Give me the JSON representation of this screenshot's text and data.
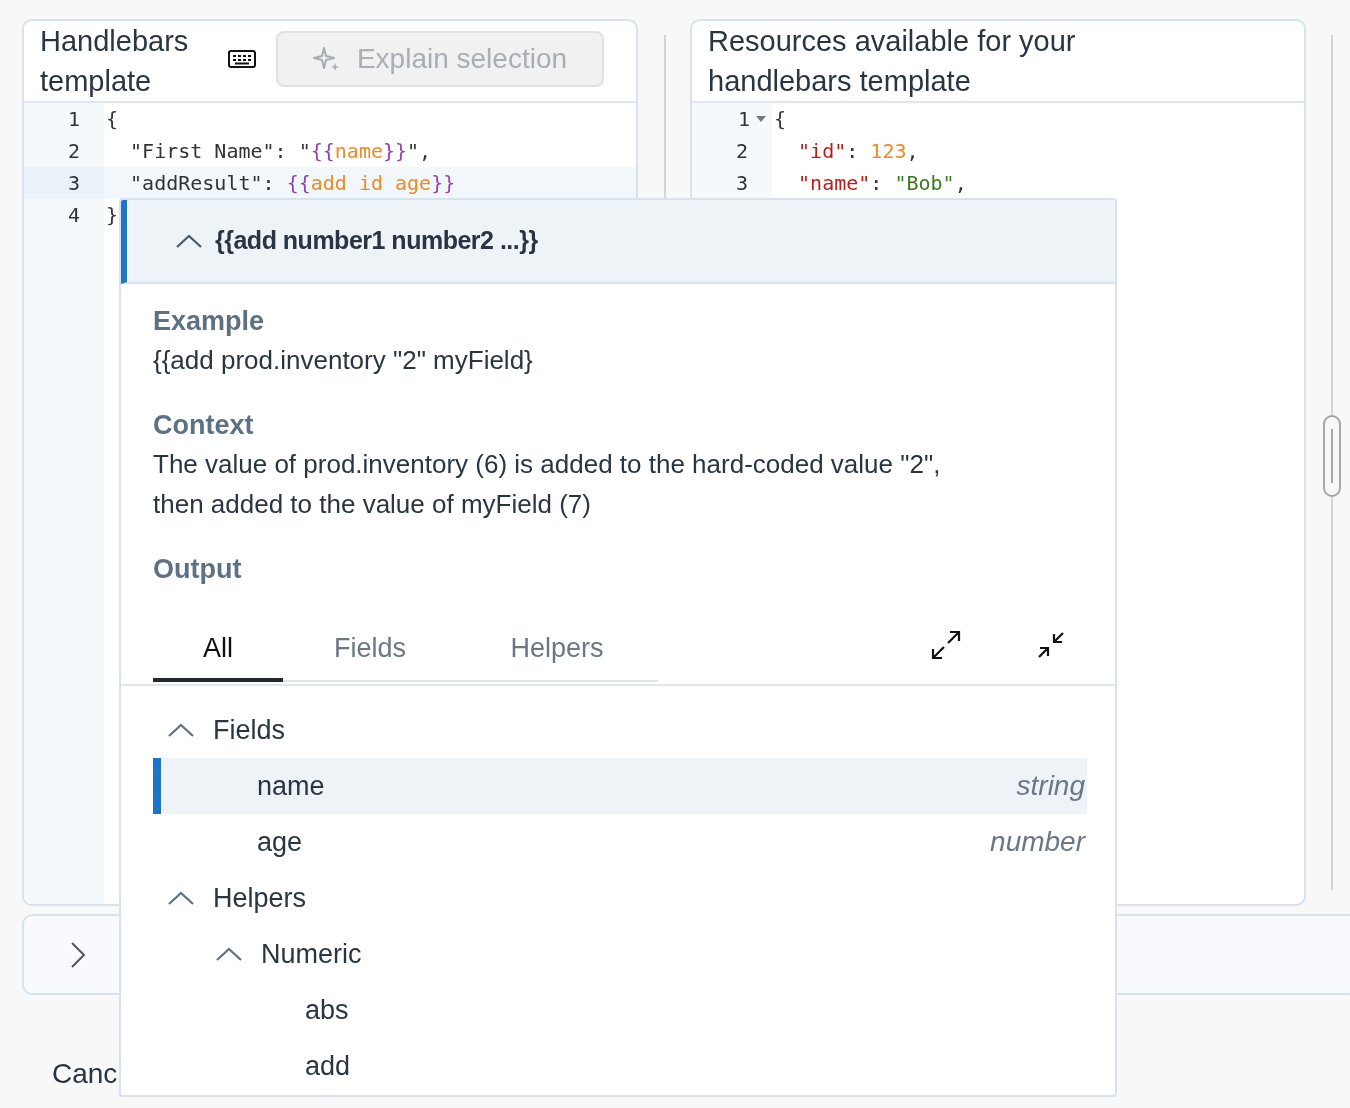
{
  "template_panel": {
    "title": "Handlebars template",
    "explain_button": {
      "label": "Explain selection",
      "disabled": true
    },
    "lines": [
      {
        "number": "1",
        "active": false,
        "tokens": [
          {
            "text": "{",
            "kind": "plain"
          }
        ]
      },
      {
        "number": "2",
        "active": false,
        "tokens": [
          {
            "text": "  \"First Name\": \"",
            "kind": "plain"
          },
          {
            "text": "{{",
            "kind": "brace"
          },
          {
            "text": "name",
            "kind": "helper"
          },
          {
            "text": "}}",
            "kind": "brace"
          },
          {
            "text": "\",",
            "kind": "plain"
          }
        ]
      },
      {
        "number": "3",
        "active": true,
        "tokens": [
          {
            "text": "  \"addResult\": ",
            "kind": "plain"
          },
          {
            "text": "{{",
            "kind": "brace"
          },
          {
            "text": "add id age",
            "kind": "helper"
          },
          {
            "text": "}}",
            "kind": "brace"
          }
        ]
      },
      {
        "number": "4",
        "active": false,
        "tokens": [
          {
            "text": "}",
            "kind": "plain"
          }
        ]
      }
    ]
  },
  "resources_panel": {
    "title": "Resources available for your handlebars template",
    "lines": [
      {
        "number": "1",
        "foldable": true,
        "tokens": [
          {
            "text": "{",
            "kind": "plain"
          }
        ]
      },
      {
        "number": "2",
        "foldable": false,
        "tokens": [
          {
            "text": "  \"id\"",
            "kind": "key"
          },
          {
            "text": ": ",
            "kind": "plain"
          },
          {
            "text": "123",
            "kind": "number"
          },
          {
            "text": ",",
            "kind": "plain"
          }
        ]
      },
      {
        "number": "3",
        "foldable": false,
        "tokens": [
          {
            "text": "  \"name\"",
            "kind": "key"
          },
          {
            "text": ": ",
            "kind": "plain"
          },
          {
            "text": "\"Bob\"",
            "kind": "string"
          },
          {
            "text": ",",
            "kind": "plain"
          }
        ]
      }
    ]
  },
  "bottom_panel": {
    "expanded": false
  },
  "cancel_button": {
    "label": "Canc"
  },
  "helper_popup": {
    "signature": "{{add number1 number2 ...}}",
    "expanded": true,
    "sections": [
      {
        "heading": "Example",
        "text": "{{add prod.inventory \"2\" myField}"
      },
      {
        "heading": "Context",
        "text": "The value of prod.inventory (6) is added to the hard-coded value \"2\", then added to the value of myField (7)"
      },
      {
        "heading": "Output"
      }
    ],
    "tabs": [
      {
        "label": "All",
        "selected": true
      },
      {
        "label": "Fields",
        "selected": false
      },
      {
        "label": "Helpers",
        "selected": false
      }
    ],
    "tree": [
      {
        "label": "Fields",
        "expanded": true,
        "children": [
          {
            "label": "name",
            "type": "string",
            "selected": true
          },
          {
            "label": "age",
            "type": "number",
            "selected": false
          }
        ]
      },
      {
        "label": "Helpers",
        "expanded": true,
        "children": [
          {
            "label": "Numeric",
            "expanded": true,
            "children": [
              {
                "label": "abs",
                "selected": false
              },
              {
                "label": "add",
                "selected": false
              }
            ]
          }
        ]
      }
    ]
  }
}
